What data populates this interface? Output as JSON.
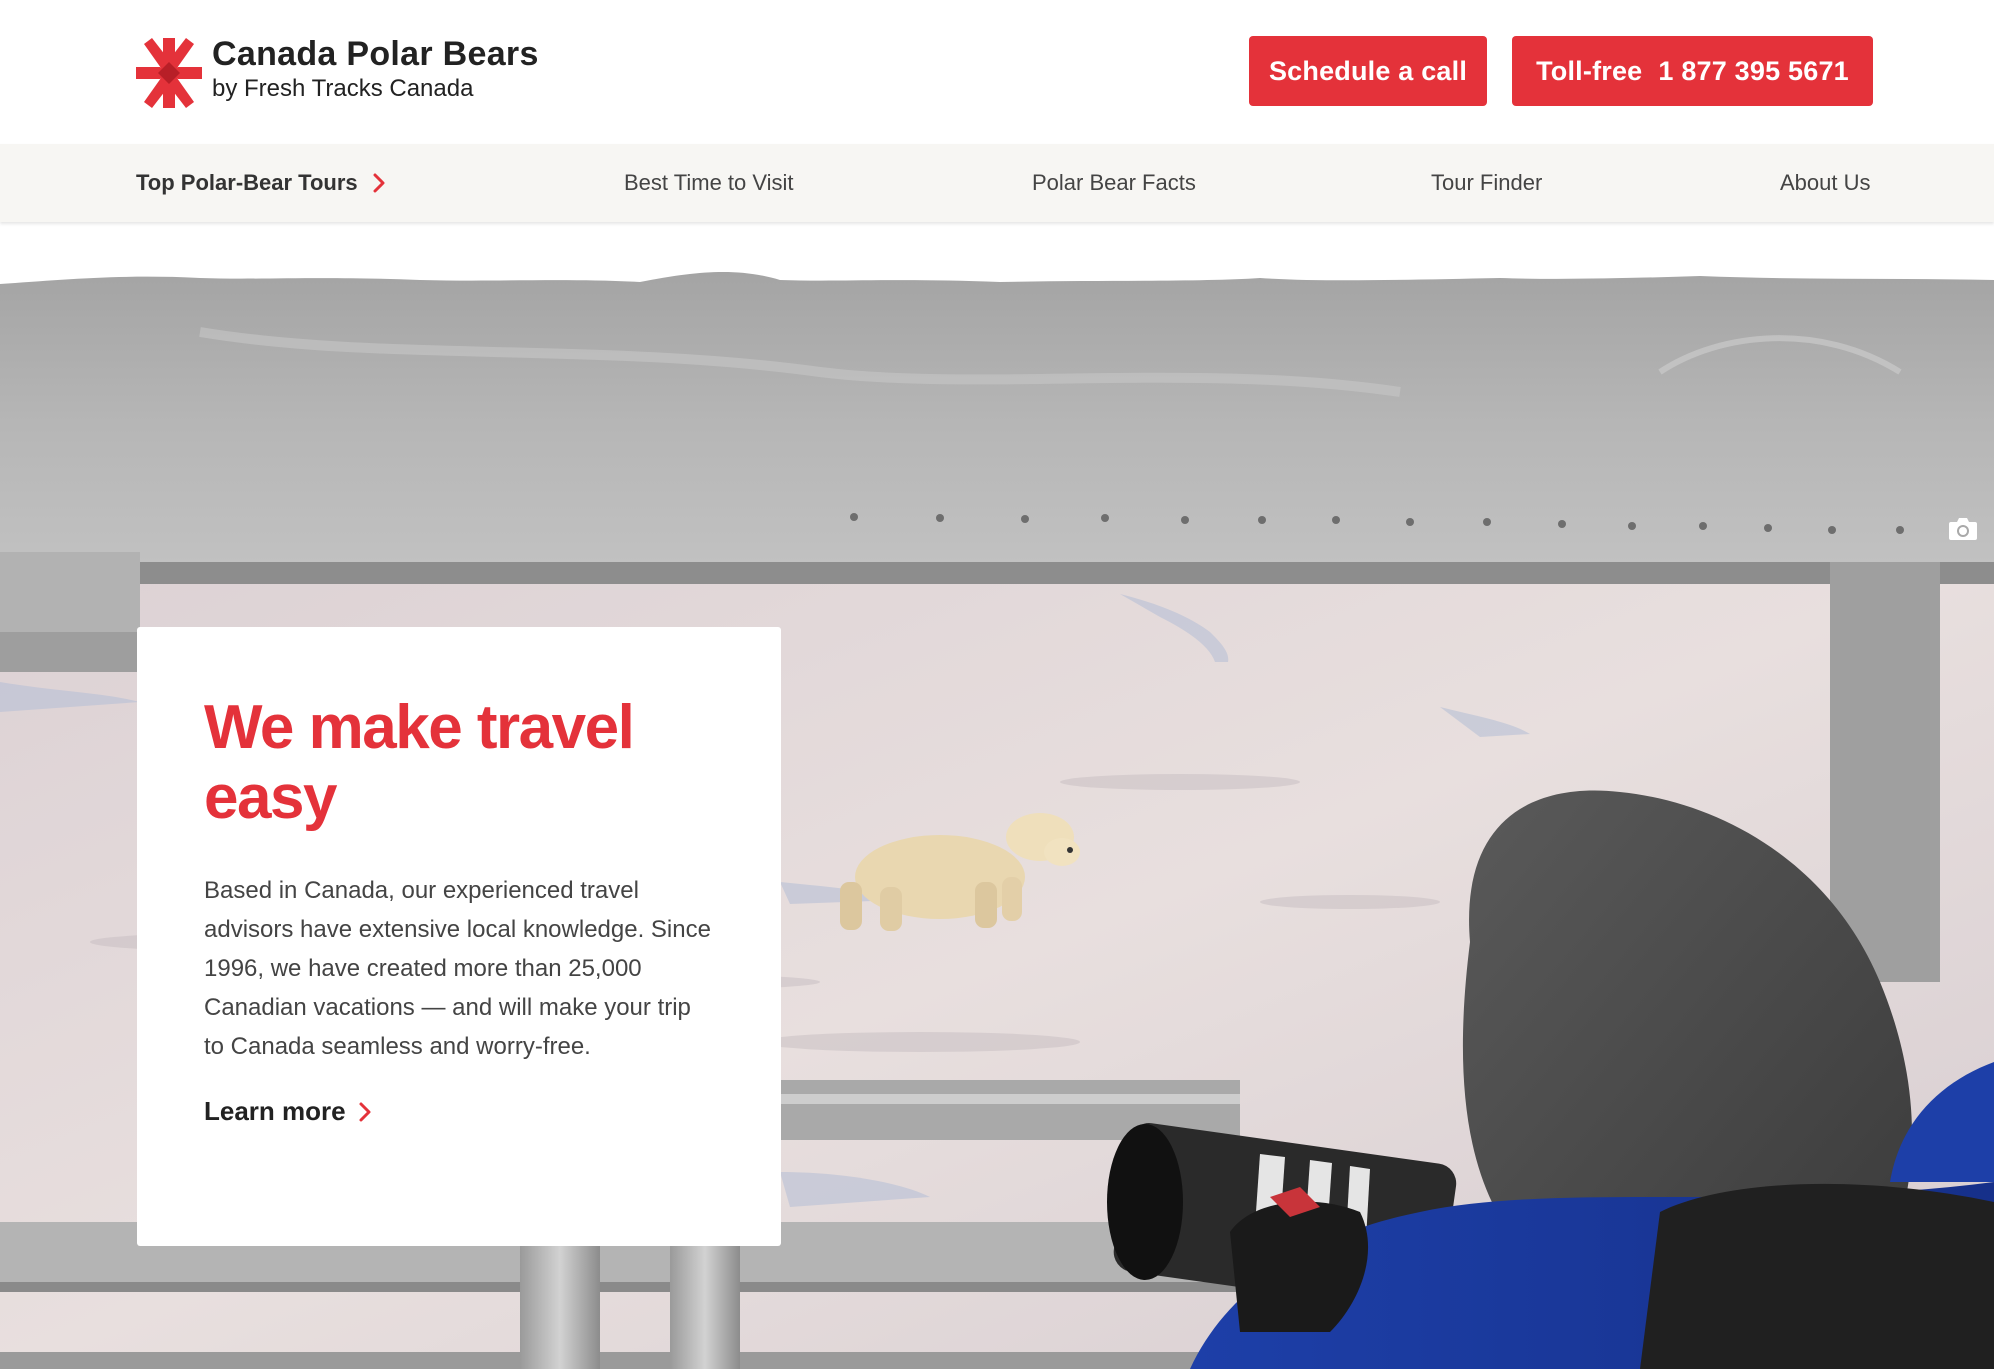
{
  "header": {
    "logo_title": "Canada Polar Bears",
    "logo_subtitle": "by Fresh Tracks Canada",
    "schedule_label": "Schedule a call",
    "tollfree_label": "Toll-free",
    "tollfree_number": "1 877 395 5671"
  },
  "nav": {
    "items": [
      {
        "label": "Top Polar-Bear Tours"
      },
      {
        "label": "Best Time to Visit"
      },
      {
        "label": "Polar Bear Facts"
      },
      {
        "label": "Tour Finder"
      },
      {
        "label": "About Us"
      }
    ]
  },
  "hero": {
    "title": "We make travel easy",
    "body": "Based in Canada, our experienced travel advisors have extensive local knowledge. Since 1996, we have created more than 25,000 Canadian vacations — and will make your trip to Canada seamless and worry-free.",
    "link_label": "Learn more"
  },
  "colors": {
    "brand_red": "#e4323a",
    "nav_background": "#f7f6f3"
  },
  "icons": [
    "maple-leaf-logo-icon",
    "chevron-right-icon",
    "camera-icon"
  ]
}
